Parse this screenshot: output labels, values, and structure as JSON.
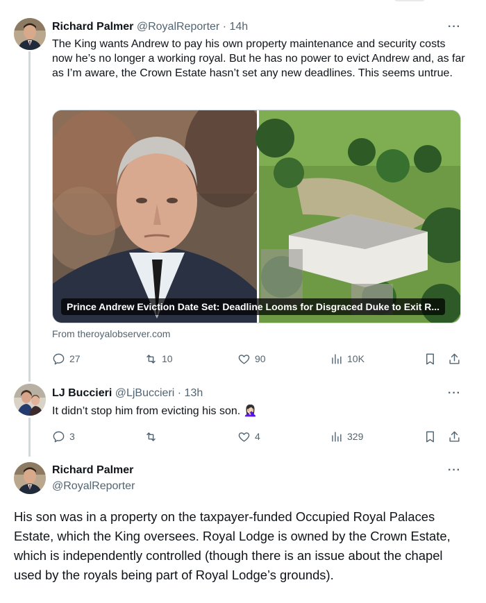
{
  "tweets": [
    {
      "name": "Richard Palmer",
      "handle": "@RoyalReporter",
      "time": "14h",
      "text": "The King wants Andrew to pay his own property maintenance and security costs now he’s no longer a working royal.  But he has no power to evict Andrew and, as far as I’m aware, the Crown Estate hasn’t set any new deadlines. This seems untrue.",
      "card": {
        "caption": "Prince Andrew Eviction Date Set: Deadline Looms for Disgraced Duke to Exit R...",
        "source": "From theroyalobserver.com"
      },
      "stats": {
        "replies": "27",
        "retweets": "10",
        "likes": "90",
        "views": "10K"
      }
    },
    {
      "name": "LJ Buccieri",
      "handle": "@LjBuccieri",
      "time": "13h",
      "text": "It didn’t stop him from evicting his son. 🤦🏻‍♀️",
      "stats": {
        "replies": "3",
        "retweets": "",
        "likes": "4",
        "views": "329"
      }
    },
    {
      "name": "Richard Palmer",
      "handle": "@RoyalReporter",
      "text": "His son was in a property on the taxpayer-funded Occupied Royal Palaces Estate, which the King oversees. Royal Lodge is owned by the Crown Estate, which is independently controlled (though there is an issue about the chapel used by the royals being part of Royal Lodge’s grounds)."
    }
  ],
  "separator": " · ",
  "more_label": "···",
  "icons": {
    "reply": "reply-icon",
    "retweet": "retweet-icon",
    "like": "heart-icon",
    "views": "views-bar-icon",
    "bookmark": "bookmark-icon",
    "share": "share-icon",
    "more": "more-dots-icon"
  },
  "colors": {
    "text": "#0f1419",
    "secondary": "#536471",
    "thread_line": "#cfd9de",
    "background": "#ffffff"
  }
}
